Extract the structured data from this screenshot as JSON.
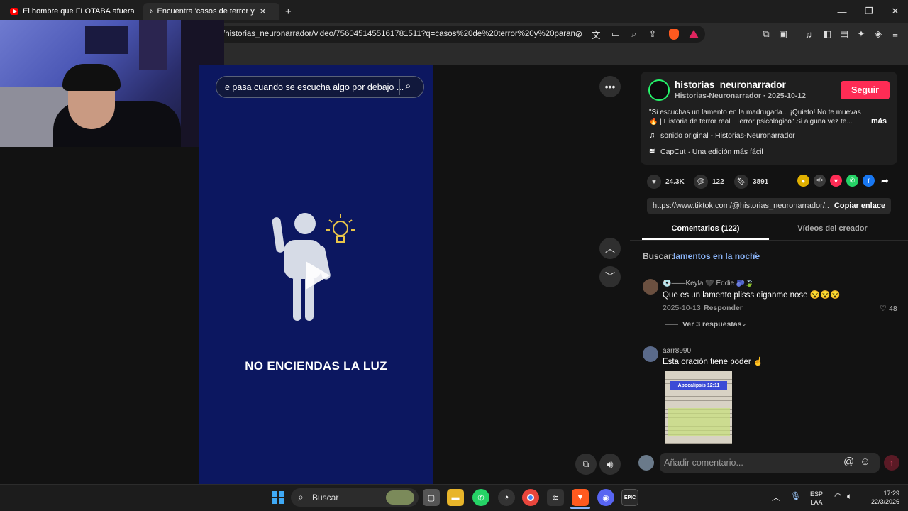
{
  "tabs": [
    {
      "title": "El hombre que FLOTABA afuera de M",
      "active": false
    },
    {
      "title": "Encuentra 'casos de terror y para",
      "active": true
    }
  ],
  "address": {
    "url": "/historias_neuronarrador/video/7560451455161781511?q=casos%20de%20terror%20y%20paran..."
  },
  "video": {
    "search_text": "e pasa cuando se escucha algo por debajo ...",
    "title": "NO ENCIENDAS LA LUZ"
  },
  "creator": {
    "username": "historias_neuronarrador",
    "display_line": "Historias-Neuronarrador · 2025-10-12",
    "follow_label": "Seguir",
    "desc_line1": "\"Si escuchas un lamento en la madrugada... ¡Quieto! No te muevas",
    "desc_line2": "🔥 | Historia de terror real | Terror psicológico\" Si alguna vez te...",
    "more_label": "más",
    "sound": "sonido original - Historias-Neuronarrador",
    "capcut": "CapCut · Una edición más fácil"
  },
  "stats": {
    "likes": "24.3K",
    "comments": "122",
    "saves": "3891"
  },
  "link": {
    "url": "https://www.tiktok.com/@historias_neuronarrador/...",
    "copy_label": "Copiar enlace"
  },
  "panel_tabs": {
    "comments": "Comentarios (122)",
    "creator_videos": "Vídeos del creador"
  },
  "search_suggest": {
    "prefix": "Buscar:",
    "query": "lamentos en la noche"
  },
  "comments": [
    {
      "author": "💿——Keyla 🖤 Eddie 🫐🍃",
      "text": "Que es un lamento plisss diganme nose 😵😵😵",
      "date": "2025-10-13",
      "reply_label": "Responder",
      "likes": "48",
      "replies_label": "Ver 3 respuestas"
    },
    {
      "author": "aarr8990",
      "text": "Esta oración tiene poder ☝️",
      "image_caption": "Apocalipsis 12:11"
    }
  ],
  "comment_input": {
    "placeholder": "Añadir comentario..."
  },
  "taskbar": {
    "search_label": "Buscar",
    "lang_line1": "ESP",
    "lang_line2": "LAA",
    "time": "17:29",
    "date": "22/3/2026"
  },
  "colors": {
    "follow": "#fe2c55",
    "video_bg": "#0c1760",
    "link_blue": "#8ab4f8"
  }
}
